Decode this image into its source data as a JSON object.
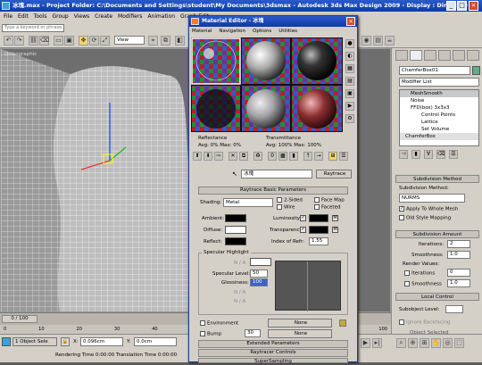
{
  "app": {
    "title": "冰塊.max   - Project Folder: C:\\Documents and Settings\\student\\My Documents\\3dsmax    - Autodesk 3ds Max Design 2009    - Display : Direct 3D",
    "window_buttons": [
      "_",
      "□",
      "×"
    ]
  },
  "menu": [
    "Edit",
    "Tools",
    "Group",
    "Views",
    "Create",
    "Modifiers",
    "Animation",
    "Graph Edit"
  ],
  "menu_file_short": "File",
  "toolbar": {
    "search_placeholder": "Type a keyword or phrase",
    "view_dropdown": "View",
    "tool_glyphs": [
      "↶",
      "↷",
      "⧉",
      "⛓",
      "⌫",
      "◧",
      "▭",
      "▣",
      "✥",
      "⟳",
      "⤢",
      "⌖"
    ]
  },
  "viewport": {
    "label": "Orthographic"
  },
  "command_panel": {
    "object_name": "ChamferBox01",
    "modifier_list": "Modifier List",
    "stack": [
      {
        "label": "MeshSmooth",
        "selected": true
      },
      {
        "label": "Noise",
        "selected": false
      },
      {
        "label": "FFD(box) 3x3x3",
        "selected": false
      },
      {
        "label": "Control Points",
        "selected": false,
        "sub": true
      },
      {
        "label": "Lattice",
        "selected": false,
        "sub": true
      },
      {
        "label": "Set Volume",
        "selected": false,
        "sub": true
      },
      {
        "label": "ChamferBox",
        "selected": false
      }
    ],
    "subdivision_method": {
      "header": "Subdivision Method",
      "label": "Subdivision Method:",
      "value": "NURMS",
      "apply_whole_mesh": "Apply To Whole Mesh",
      "old_style": "Old Style Mapping"
    },
    "subdivision_amount": {
      "header": "Subdivision Amount",
      "iterations_label": "Iterations:",
      "iterations": "2",
      "smoothness_label": "Smoothness:",
      "smoothness": "1.0",
      "render_values": "Render Values:",
      "r_iterations_label": "Iterations",
      "r_iterations": "0",
      "r_smoothness_label": "Smoothness",
      "r_smoothness": "1.0"
    },
    "local_control": {
      "header": "Local Control",
      "sublevel_label": "Subobject Level:",
      "ignore_backfacing": "Ignore Backfacing",
      "object_selected": "Object Selected"
    }
  },
  "timeline": {
    "frame": "0 / 100",
    "ticks": [
      "0",
      "10",
      "20",
      "30",
      "40",
      "50",
      "60",
      "70",
      "80",
      "90",
      "100"
    ]
  },
  "status": {
    "selection": "1 Object Sele",
    "x_label": "X:",
    "x_value": "0.096cm",
    "y_label": "Y:",
    "y_value": "0.0cm",
    "rendering_time": "Rendering Time  0:00:00",
    "translation_time": "Translation Time  0:00:00"
  },
  "material_editor": {
    "title": "Material Editor - 冰塊",
    "menu": [
      "Material",
      "Navigation",
      "Options",
      "Utilities"
    ],
    "reflectance": {
      "label": "Reflectance",
      "values": "Avg:  0% Max:    0%"
    },
    "transmittance": {
      "label": "Transmittance",
      "values": "Avg: 100% Max: 100%"
    },
    "material_name": "冰塊",
    "type_button": "Raytrace",
    "rollouts": {
      "basic": "Raytrace Basic Parameters",
      "extended": "Extended Parameters",
      "controls": "Raytracer Controls",
      "supersampling": "SuperSampling"
    },
    "shading": {
      "label": "Shading:",
      "value": "Metal"
    },
    "checkboxes": [
      {
        "label": "2-Sided",
        "checked": false
      },
      {
        "label": "Face Map",
        "checked": false
      },
      {
        "label": "Wire",
        "checked": false
      },
      {
        "label": "Faceted",
        "checked": false
      }
    ],
    "colors": {
      "ambient": {
        "label": "Ambient:",
        "color": "#000000"
      },
      "diffuse": {
        "label": "Diffuse:",
        "color": "#ffffff"
      },
      "reflect": {
        "label": "Reflect:",
        "color": "#000000"
      },
      "luminosity": {
        "label": "Luminosity:",
        "color": "#000000"
      },
      "transparency": {
        "label": "Transparency:",
        "color": "#000000"
      }
    },
    "index_of_refr": {
      "label": "Index of Refr:",
      "value": "1.55"
    },
    "specular": {
      "group": "Specular Highlight",
      "na": "N / A",
      "level_label": "Specular Level:",
      "level": "50",
      "gloss_label": "Glossiness:",
      "gloss": "100"
    },
    "environment": {
      "label": "Environment",
      "value": "None"
    },
    "bump": {
      "label": "Bump",
      "amount": "30",
      "value": "None"
    },
    "map_buttons": [
      "M",
      "M"
    ]
  },
  "colors": {
    "titlebar": "#0c3aa5",
    "panel": "#d4d0c8",
    "viewport": "#6e6e6e",
    "active_slot": "#ffffff"
  }
}
